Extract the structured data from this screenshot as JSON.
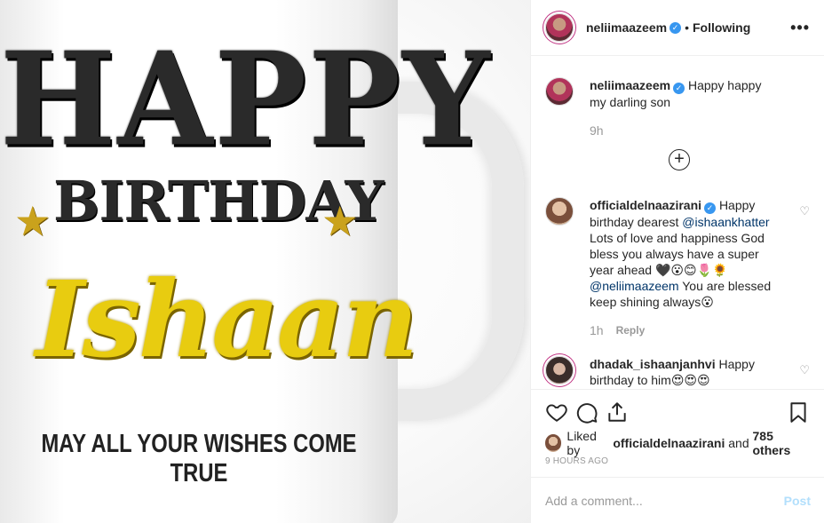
{
  "image": {
    "line1": "HAPPY",
    "line2": "BIRTHDAY",
    "name": "Ishaan",
    "tagline": "MAY ALL YOUR WISHES COME TRUE",
    "star": "★"
  },
  "header": {
    "username": "neliimaazeem",
    "verified_mark": "✓",
    "separator": "•",
    "follow_status": "Following",
    "more": "•••"
  },
  "caption": {
    "username": "neliimaazeem",
    "text": "Happy happy my darling son",
    "time": "9h"
  },
  "load_more": "+",
  "comments": [
    {
      "username": "officialdelnaazirani",
      "text_a": "Happy birthday dearest",
      "mention_a": "@ishaankhatter",
      "text_b": "Lots of love and happiness God bless you always have a super year ahead 🖤😮😊🌷🌻",
      "mention_b": "@neliimaazeem",
      "text_c": "You are blessed keep shining always😮",
      "time": "1h",
      "reply": "Reply"
    },
    {
      "username": "dhadak_ishaanjanhvi",
      "text_a": "Happy birthday to him😍😍😍"
    }
  ],
  "likes": {
    "prefix": "Liked by",
    "user": "officialdelnaazirani",
    "and": "and",
    "count": "785 others"
  },
  "posted_time": "9 HOURS AGO",
  "add_comment": {
    "placeholder": "Add a comment...",
    "post_label": "Post"
  },
  "colors": {
    "verified": "#3897f0",
    "mention": "#003569",
    "gold": "#e8cc10",
    "post_disabled": "#b2dffc"
  }
}
